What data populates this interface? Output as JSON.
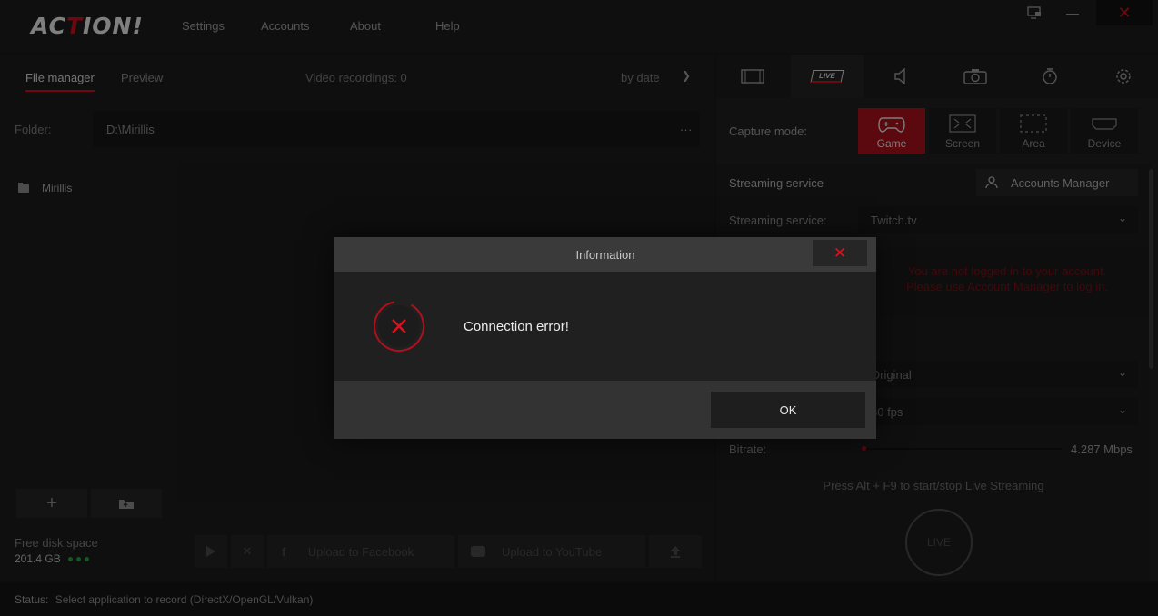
{
  "app": {
    "logo_text_a": "AC",
    "logo_text_o": "T",
    "logo_text_b": "ION!"
  },
  "menu": [
    {
      "label": "Settings"
    },
    {
      "label": "Accounts"
    },
    {
      "label": "About"
    },
    {
      "label": "Help"
    }
  ],
  "window": {
    "close_glyph": "✕",
    "minimize_glyph": "—"
  },
  "left": {
    "tabs": [
      {
        "label": "File manager"
      },
      {
        "label": "Preview"
      }
    ],
    "recordings": "Video recordings: 0",
    "sort": "by date",
    "folder_label": "Folder:",
    "folder_path": "D:\\Mirillis",
    "folder_more": "...",
    "tree_item": "Mirillis",
    "add_glyph": "+",
    "disk_label": "Free disk space",
    "disk_value": "201.4 GB"
  },
  "actions": {
    "upload_facebook": "Upload to Facebook",
    "upload_youtube": "Upload to YouTube"
  },
  "status": {
    "label": "Status:",
    "text": "Select application to record  (DirectX/OpenGL/Vulkan)"
  },
  "right": {
    "live_label": "LIVE",
    "capture_label": "Capture mode:",
    "capture_modes": [
      {
        "label": "Game"
      },
      {
        "label": "Screen"
      },
      {
        "label": "Area"
      },
      {
        "label": "Device"
      }
    ],
    "streaming_title": "Streaming service",
    "accounts_manager": "Accounts Manager",
    "service_label": "Streaming service:",
    "service_value": "Twitch.tv",
    "warning_line1": "You are not logged in to your account.",
    "warning_line2": "Please use Account Manager to log in.",
    "resolution_value": "Original",
    "fps_value": "30 fps",
    "bitrate_label": "Bitrate:",
    "bitrate_value": "4.287 Mbps",
    "hint": "Press Alt + F9 to start/stop Live Streaming",
    "live_button": "LIVE"
  },
  "dialog": {
    "title": "Information",
    "close_glyph": "✕",
    "message": "Connection error!",
    "ok": "OK"
  },
  "colors": {
    "accent": "#c8101e",
    "disk_ok": "#1fa33a"
  }
}
